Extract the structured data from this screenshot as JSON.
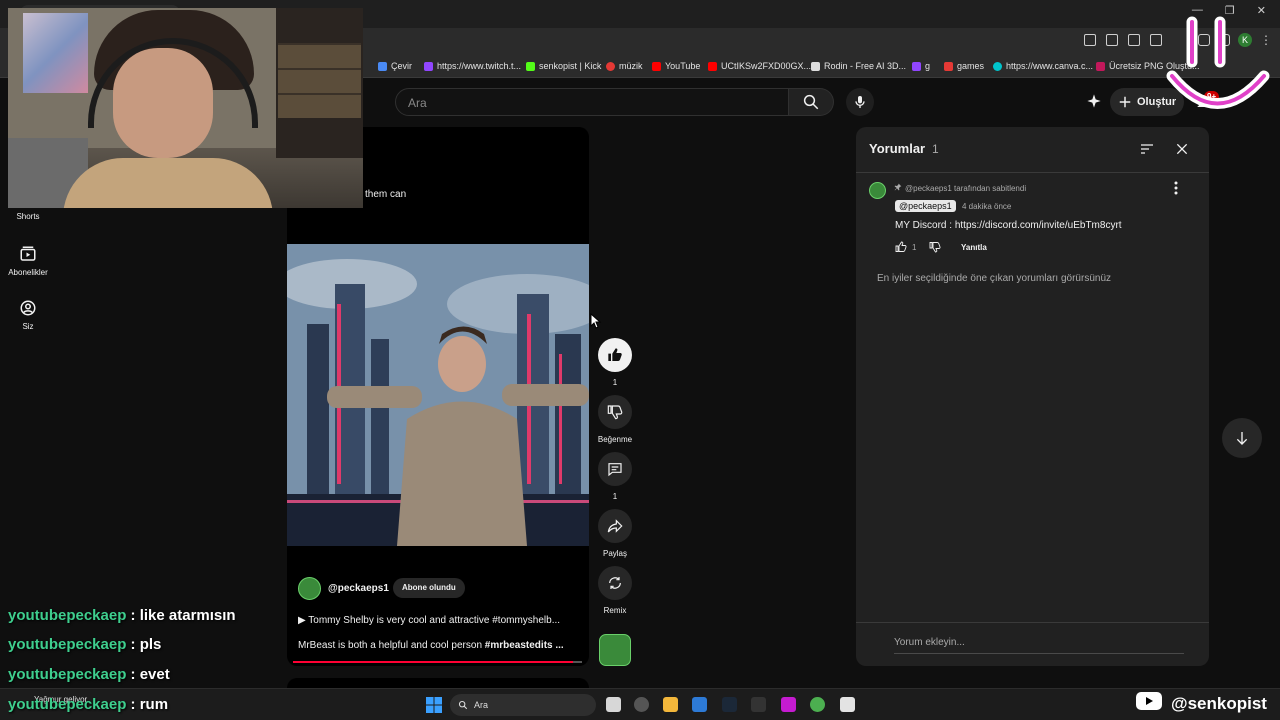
{
  "browser": {
    "window_controls": [
      "—",
      "❐",
      "✕"
    ],
    "profile_initial": "K",
    "bookmarks": [
      {
        "label": "Çevir",
        "color": "#4a8af4"
      },
      {
        "label": "https://www.twitch.t...",
        "color": "#9146ff"
      },
      {
        "label": "senkopist | Kick",
        "color": "#53fc18"
      },
      {
        "label": "müzik",
        "color": "#e53935"
      },
      {
        "label": "YouTube",
        "color": "#ff0000"
      },
      {
        "label": "UCtIKSw2FXD00GX...",
        "color": "#ff0000"
      },
      {
        "label": "Rodin - Free AI 3D...",
        "color": "#dddddd"
      },
      {
        "label": "g",
        "color": "#9146ff"
      },
      {
        "label": "games",
        "color": "#e53935"
      },
      {
        "label": "https://www.canva.c...",
        "color": "#00c4cc"
      },
      {
        "label": "Ücretsiz PNG Oluştu...",
        "color": "#c2185b"
      }
    ]
  },
  "masthead": {
    "search_placeholder": "Ara",
    "create_label": "Oluştur",
    "notification_count": "9+"
  },
  "sidebar": {
    "items": [
      {
        "label": "Shorts",
        "icon": "shorts-icon"
      },
      {
        "label": "Abonelikler",
        "icon": "subscriptions-icon"
      },
      {
        "label": "Siz",
        "icon": "you-icon"
      }
    ]
  },
  "short": {
    "previous_caption": "them can",
    "channel": "@peckaeps1",
    "subscribe_label": "Abone olundu",
    "title": "▶  Tommy Shelby is very cool and attractive #tommyshelb...",
    "description_plain": "MrBeast is both a helpful and cool person ",
    "description_tags": "#mrbeastedits ...",
    "progress": 0.97
  },
  "actions": {
    "like_count": "1",
    "dislike_label": "Beğenme",
    "comment_count": "1",
    "share_label": "Paylaş",
    "remix_label": "Remix"
  },
  "comments": {
    "title": "Yorumlar",
    "count": "1",
    "pinned_note": "@peckaeps1 tarafından sabitlendi",
    "author": "@peckaeps1",
    "time": "4 dakika önce",
    "text": "MY Discord : https://discord.com/invite/uEbTm8cyrt",
    "like_count": "1",
    "reply_label": "Yanıtla",
    "footer_note": "En iyiler seçildiğinde öne çıkan yorumları görürsünüz",
    "add_placeholder": "Yorum ekleyin..."
  },
  "chat": [
    {
      "user": "youtubepeckaep",
      "message": " : like atarmısın"
    },
    {
      "user": "youtubepeckaep",
      "message": " : pls"
    },
    {
      "user": "youtubepeckaep",
      "message": " : evet"
    },
    {
      "user": "youtubepeckaep",
      "message": " : rum"
    }
  ],
  "taskbar": {
    "weather": "Yağmur geliyor",
    "search_label": "Ara"
  },
  "watermark": {
    "name": "@senkopist"
  }
}
